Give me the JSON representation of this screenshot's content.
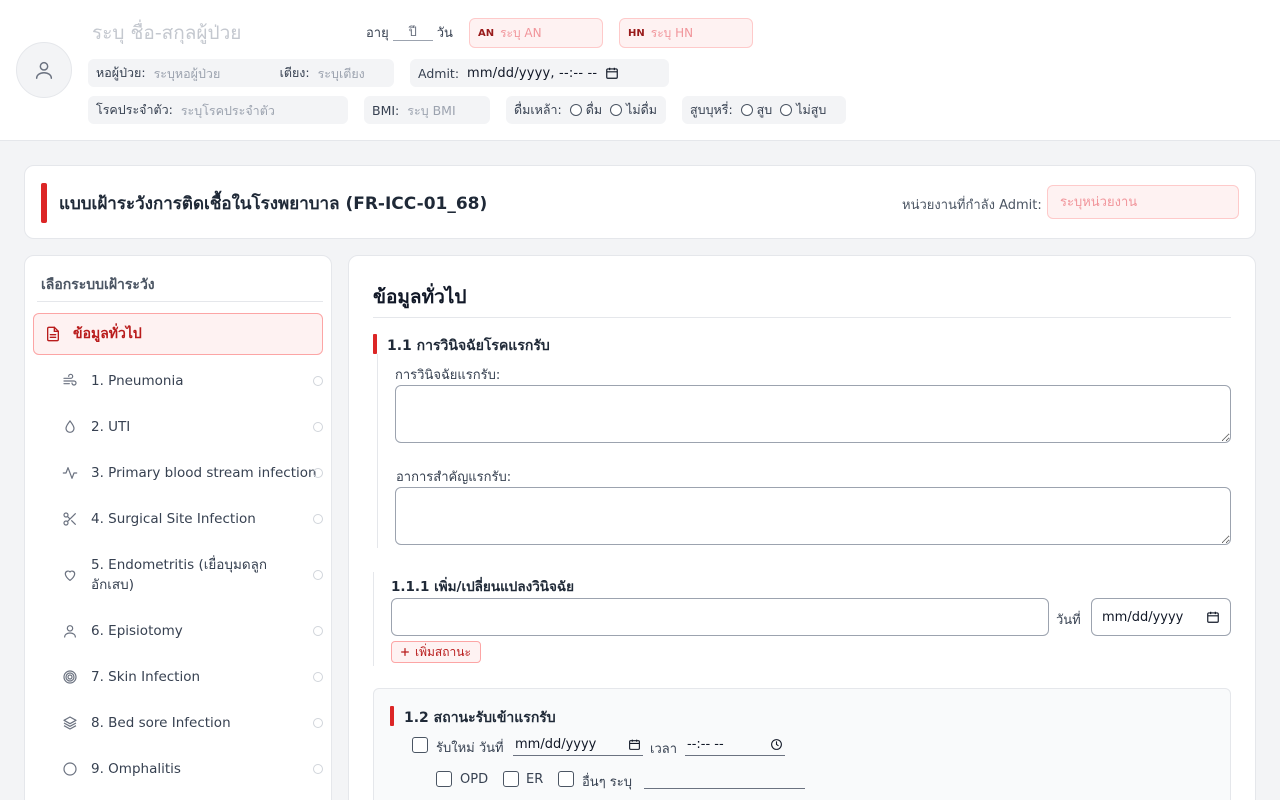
{
  "patient": {
    "name_placeholder": "ระบุ ชื่อ-สกุลผู้ป่วย",
    "age_label": "อายุ",
    "age_unit_placeholder": "ปี",
    "day_label": "วัน",
    "an": {
      "tag": "AN",
      "placeholder": "ระบุ AN"
    },
    "hn": {
      "tag": "HN",
      "placeholder": "ระบุ HN"
    },
    "ward": {
      "label": "หอผู้ป่วย:",
      "placeholder": "ระบุหอผู้ป่วย"
    },
    "bed": {
      "label": "เตียง:",
      "placeholder": "ระบุเตียง"
    },
    "admit": {
      "label": "Admit:",
      "value": "mm/dd/yyyy, --:-- --"
    },
    "disease": {
      "label": "โรคประจำตัว:",
      "placeholder": "ระบุโรคประจำตัว"
    },
    "bmi": {
      "label": "BMI:",
      "placeholder": "ระบุ BMI"
    },
    "alcohol": {
      "label": "ดื่มเหล้า:",
      "options": [
        "ดื่ม",
        "ไม่ดื่ม"
      ]
    },
    "smoking": {
      "label": "สูบบุหรี่:",
      "options": [
        "สูบ",
        "ไม่สูบ"
      ]
    }
  },
  "form": {
    "title": "แบบเฝ้าระวังการติดเชื้อในโรงพยาบาล (FR-ICC-01_68)",
    "unit_label": "หน่วยงานที่กำลัง Admit:",
    "unit_placeholder": "ระบุหน่วยงาน"
  },
  "sidebar": {
    "heading": "เลือกระบบเฝ้าระวัง",
    "active": {
      "label": "ข้อมูลทั่วไป",
      "icon": "document-icon"
    },
    "items": [
      {
        "label": "1. Pneumonia",
        "icon": "wind-icon"
      },
      {
        "label": "2. UTI",
        "icon": "droplet-icon"
      },
      {
        "label": "3. Primary blood stream infection",
        "icon": "activity-icon"
      },
      {
        "label": "4. Surgical Site Infection",
        "icon": "scissors-icon"
      },
      {
        "label": "5. Endometritis (เยื่อบุมดลูกอักเสบ)",
        "icon": "heart-icon"
      },
      {
        "label": "6. Episiotomy",
        "icon": "user-icon"
      },
      {
        "label": "7. Skin Infection",
        "icon": "target-icon"
      },
      {
        "label": "8. Bed sore Infection",
        "icon": "layers-icon"
      },
      {
        "label": "9. Omphalitis",
        "icon": "circle-icon"
      }
    ]
  },
  "main": {
    "title": "ข้อมูลทั่วไป",
    "s11": {
      "title": "1.1 การวินิจฉัยโรคแรกรับ",
      "diagnosis_label": "การวินิจฉัยแรกรับ:",
      "symptom_label": "อาการสำคัญแรกรับ:"
    },
    "s111": {
      "title": "1.1.1 เพิ่ม/เปลี่ยนแปลงวินิจฉัย",
      "date_label": "วันที่",
      "date_placeholder": "mm/dd/yyyy",
      "add_button": "เพิ่มสถานะ"
    },
    "s12": {
      "title": "1.2 สถานะรับเข้าแรกรับ",
      "new_admit_label": "รับใหม่ วันที่",
      "date_placeholder": "mm/dd/yyyy",
      "time_label": "เวลา",
      "time_placeholder": "--:-- --",
      "opd": "OPD",
      "er": "ER",
      "other": "อื่นๆ ระบุ"
    }
  },
  "colors": {
    "accent": "#dc2626",
    "accent_light": "#fef2f2",
    "accent_border": "#fecaca"
  }
}
